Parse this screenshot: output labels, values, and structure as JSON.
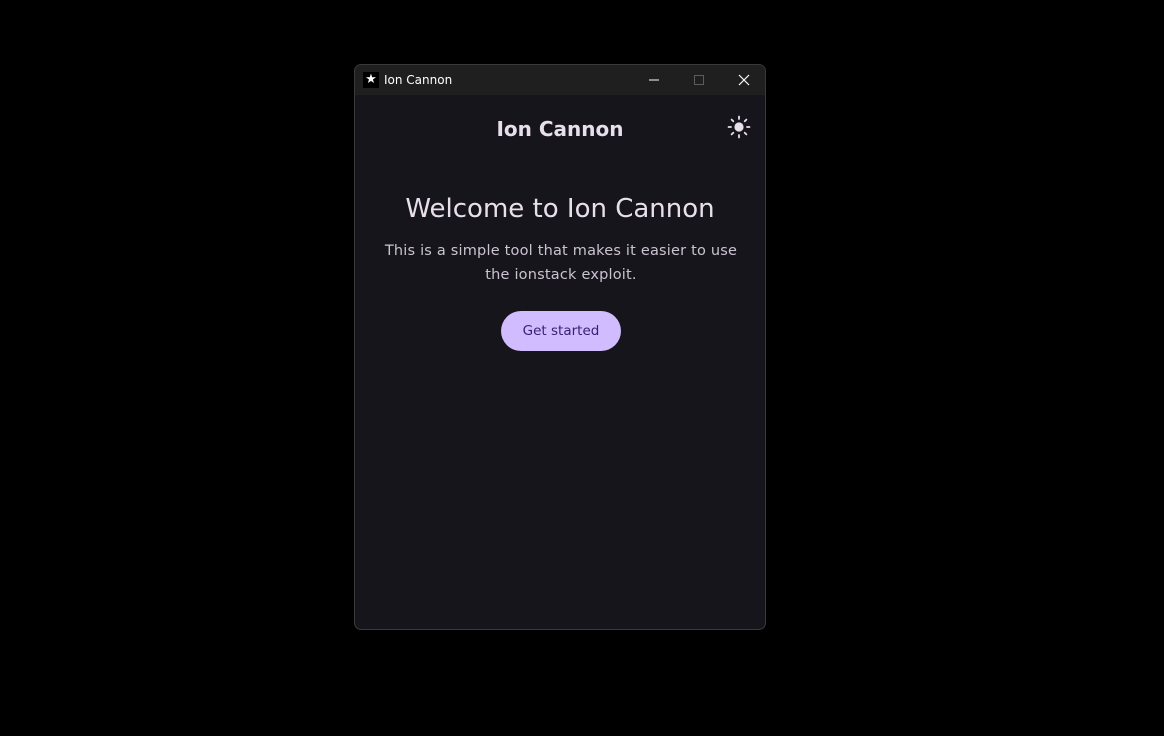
{
  "window": {
    "title": "Ion Cannon",
    "app_icon": "star-icon",
    "controls": [
      "minimize-icon",
      "maximize-icon",
      "close-icon"
    ]
  },
  "header": {
    "title": "Ion Cannon",
    "theme_toggle_icon": "sun-icon"
  },
  "main": {
    "heading": "Welcome to Ion Cannon",
    "description": "This is a simple tool that makes it easier to use the ionstack exploit.",
    "cta_label": "Get started"
  },
  "colors": {
    "background": "#17151c",
    "titlebar": "#1f1f1f",
    "primary": "#d0bcff",
    "on_primary": "#381e72",
    "text": "#e7e0ec"
  }
}
